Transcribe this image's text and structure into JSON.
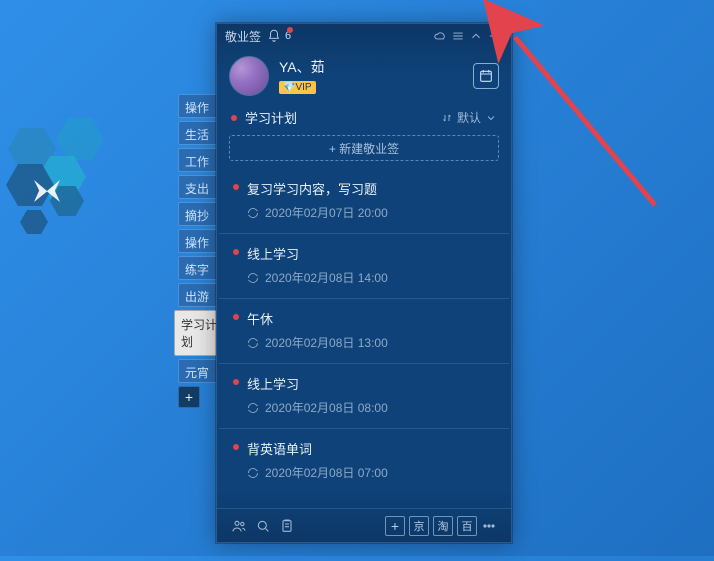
{
  "titlebar": {
    "app_name": "敬业签",
    "notification_count": "6"
  },
  "profile": {
    "username": "YA、茹",
    "vip_label": "VIP"
  },
  "section": {
    "title": "学习计划",
    "sort_label": "默认"
  },
  "new_note_label": "+ 新建敬业签",
  "side_tabs": {
    "items": [
      {
        "label": "操作"
      },
      {
        "label": "生活"
      },
      {
        "label": "工作"
      },
      {
        "label": "支出"
      },
      {
        "label": "摘抄"
      },
      {
        "label": "操作"
      },
      {
        "label": "练字"
      },
      {
        "label": "出游"
      },
      {
        "label": "学习计划"
      },
      {
        "label": "元宵"
      }
    ]
  },
  "notes": [
    {
      "title": "复习学习内容，写习题",
      "due": "2020年02月07日 20:00"
    },
    {
      "title": "线上学习",
      "due": "2020年02月08日 14:00"
    },
    {
      "title": "午休",
      "due": "2020年02月08日 13:00"
    },
    {
      "title": "线上学习",
      "due": "2020年02月08日 08:00"
    },
    {
      "title": "背英语单词",
      "due": "2020年02月08日 07:00"
    }
  ],
  "bottombar": {
    "sq1": "京",
    "sq2": "淘",
    "sq3": "百"
  }
}
